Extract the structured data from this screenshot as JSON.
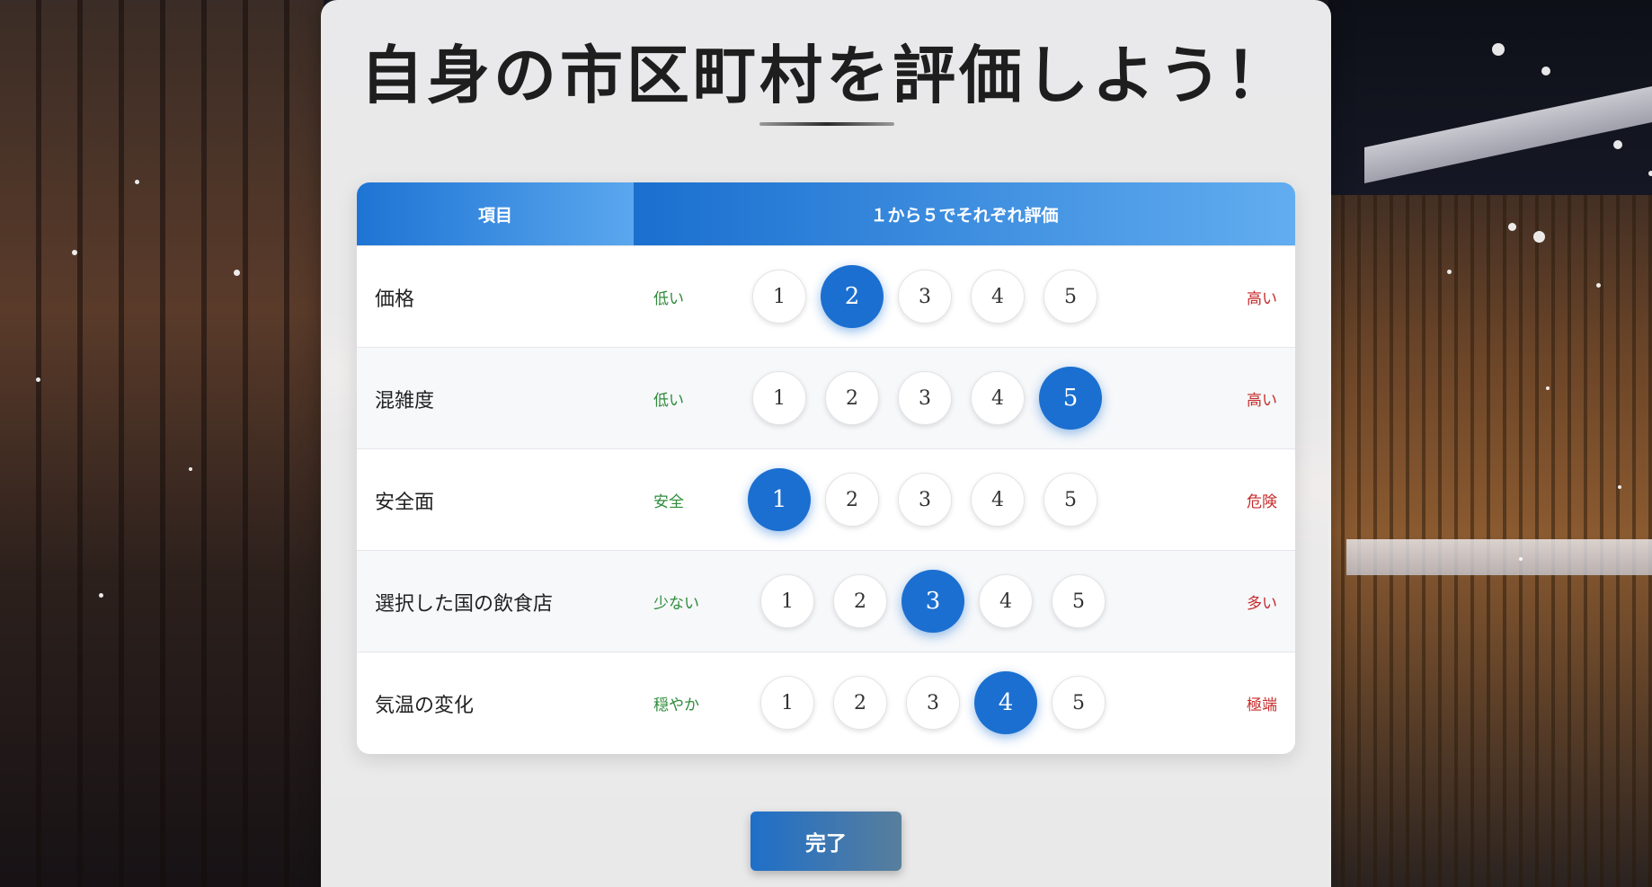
{
  "page": {
    "title": "自身の市区町村を評価しよう！"
  },
  "table": {
    "header_item": "項目",
    "header_eval": "１から５でそれぞれ評価",
    "scale_options": [
      "1",
      "2",
      "3",
      "4",
      "5"
    ],
    "rows": [
      {
        "label": "価格",
        "low": "低い",
        "high": "高い",
        "selected": 2
      },
      {
        "label": "混雑度",
        "low": "低い",
        "high": "高い",
        "selected": 5
      },
      {
        "label": "安全面",
        "low": "安全",
        "high": "危険",
        "selected": 1
      },
      {
        "label": "選択した国の飲食店",
        "low": "少ない",
        "high": "多い",
        "selected": 3
      },
      {
        "label": "気温の変化",
        "low": "穏やか",
        "high": "極端",
        "selected": 4
      }
    ]
  },
  "footer": {
    "done_label": "完了"
  },
  "colors": {
    "accent": "#1b6fd0",
    "low_text": "#2e8b3a",
    "high_text": "#c62b2b"
  }
}
